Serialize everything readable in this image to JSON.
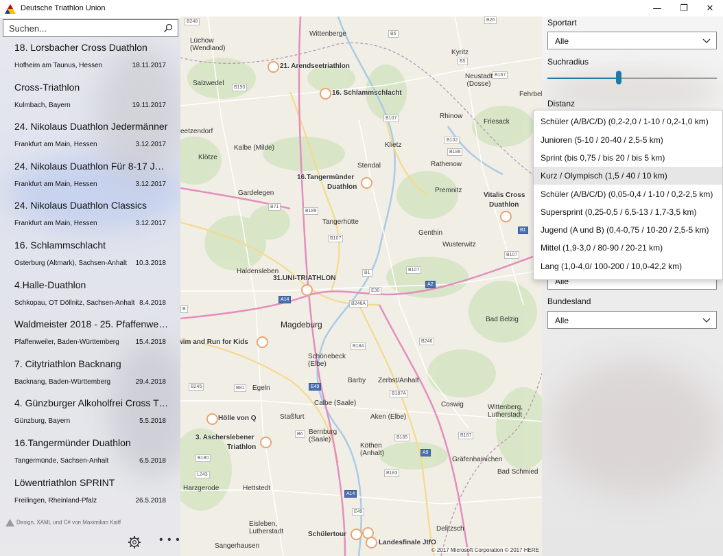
{
  "app": {
    "title": "Deutsche Triathlon Union"
  },
  "window": {
    "minimize": "—",
    "maximize": "❐",
    "close": "✕"
  },
  "search": {
    "placeholder": "Suchen..."
  },
  "events": [
    {
      "name": "18. Lorsbacher Cross Duathlon",
      "place": "Hofheim am Taunus, Hessen",
      "date": "18.11.2017"
    },
    {
      "name": "Cross-Triathlon",
      "place": "Kulmbach, Bayern",
      "date": "19.11.2017"
    },
    {
      "name": "24. Nikolaus Duathlon Jedermänner",
      "place": "Frankfurt am Main, Hessen",
      "date": "3.12.2017"
    },
    {
      "name": "24. Nikolaus Duathlon Für 8-17 Jahre",
      "place": "Frankfurt am Main, Hessen",
      "date": "3.12.2017"
    },
    {
      "name": "24. Nikolaus Duathlon Classics",
      "place": "Frankfurt am Main, Hessen",
      "date": "3.12.2017"
    },
    {
      "name": "16. Schlammschlacht",
      "place": "Osterburg (Altmark), Sachsen-Anhalt",
      "date": "10.3.2018"
    },
    {
      "name": "4.Halle-Duathlon",
      "place": "Schkopau, OT Döllnitz, Sachsen-Anhalt",
      "date": "8.4.2018"
    },
    {
      "name": "Waldmeister 2018 - 25. Pfaffenweile...",
      "place": "Pfaffenweiler, Baden-Württemberg",
      "date": "15.4.2018"
    },
    {
      "name": "7. Citytriathlon Backnang",
      "place": "Backnang, Baden-Württemberg",
      "date": "29.4.2018"
    },
    {
      "name": "4. Günzburger Alkoholfrei Cross Tria...",
      "place": "Günzburg, Bayern",
      "date": "5.5.2018"
    },
    {
      "name": "16.Tangermünder Duathlon",
      "place": "Tangermünde, Sachsen-Anhalt",
      "date": "6.5.2018"
    },
    {
      "name": "Löwentriathlon SPRINT",
      "place": "Freilingen, Rheinland-Pfalz",
      "date": "26.5.2018"
    }
  ],
  "credit": "Design, XAML und C# von Maximilian Kaiff",
  "map": {
    "pins": [
      {
        "label": "21. Arendseetriathlon"
      },
      {
        "label": "16. Schlammschlacht"
      },
      {
        "label": "16.Tangermünder"
      },
      {
        "label": "Duathlon"
      },
      {
        "label": "Vitalis Cross"
      },
      {
        "label": "Duathlon"
      },
      {
        "label": "31.UNI-TRIATHLON"
      },
      {
        "label": "wim and Run for Kids"
      },
      {
        "label": "Hölle von Q"
      },
      {
        "label": "3. Aschersleben​er"
      },
      {
        "label": "Triathlon"
      },
      {
        "label": "Schülertour"
      },
      {
        "label": "Landesfinale JtfO"
      }
    ],
    "places": [
      "Wittenberge",
      "Lüchow (Wendland)",
      "Kyritz",
      "Salzwedel",
      "Neustadt (Dosse)",
      "Fehrbelli",
      "Rhinow",
      "Friesack",
      "Klietz",
      "Rathenow",
      "Stendal",
      "Kalbe (Milde)",
      "Klötze",
      "Gardelegen",
      "Premnitz",
      "Tangerhütte",
      "Genthin",
      "Wusterwitz",
      "Haldensleben",
      "Magdeburg",
      "Schönebeck (Elbe)",
      "Bad Belzig",
      "Barby",
      "Zerbst/Anhalt",
      "Egeln",
      "Calbe (Saale)",
      "Staßfurt",
      "Aken (Elbe)",
      "Coswig",
      "Wittenberg, Lutherstadt",
      "Bernburg (Saale)",
      "Köthen (Anhalt)",
      "Gräfenhainichen",
      "Bad Schmied",
      "Harzgerode",
      "Hettstedt",
      "Eisleben, Lutherstadt",
      "Delitzsch",
      "Sangerhausen",
      "eetzendorf"
    ],
    "copyright": "© 2017 Microsoft Corporation  © 2017 HERE"
  },
  "filters": {
    "sportart_label": "Sportart",
    "sportart_value": "Alle",
    "radius_label": "Suchradius",
    "radius_value": 0.42,
    "distanz_label": "Distanz",
    "hidden_value": "Alle",
    "bundesland_label": "Bundesland",
    "bundesland_value": "Alle"
  },
  "distanz_options": [
    "Schüler (A/B/C/D) (0,2-2,0 / 1-10 / 0,2-1,0 km)",
    "Junioren (5-10 / 20-40 / 2,5-5 km)",
    "Sprint (bis 0,75 / bis 20 / bis 5 km)",
    "Kurz / Olympisch (1,5 / 40 / 10 km)",
    "Schüler (A/B/C/D) (0,05-0,4 / 1-10 / 0,2-2,5 km)",
    "Supersprint (0,25-0,5 / 6,5-13 / 1,7-3,5 km)",
    "Jugend (A und B) (0,4-0,75 / 10-20 / 2,5-5 km)",
    "Mittel (1,9-3,0 / 80-90 / 20-21 km)",
    "Lang (1,0-4,0/ 100-200 / 10,0-42,2 km)"
  ],
  "distanz_selected_index": 3,
  "colors": {
    "accent": "#1e78a8",
    "pin": "#e8a574",
    "autobahn": "#4a6fb0"
  }
}
